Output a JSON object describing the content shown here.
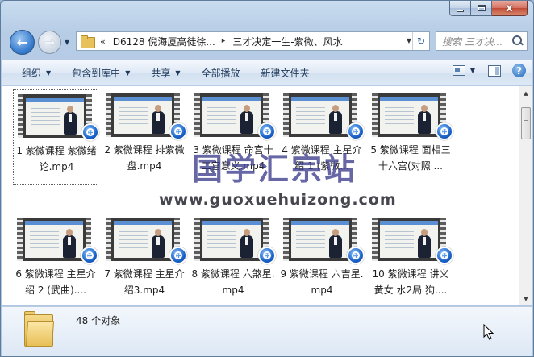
{
  "window": {
    "caption_buttons": {
      "minimize": "—",
      "maximize": "□",
      "close": "x"
    }
  },
  "navigation": {
    "back_icon": "back-arrow-icon",
    "forward_icon": "forward-arrow-icon"
  },
  "address": {
    "overflow_chevron": "«",
    "crumbs": [
      "D6128 倪海厦高徒徐...",
      "三才决定一生-紫微、风水"
    ],
    "separator": "▸"
  },
  "search": {
    "placeholder": "搜索 三才决..."
  },
  "toolbar": {
    "organize": "组织",
    "include_in_library": "包含到库中",
    "share": "共享",
    "play_all": "全部播放",
    "new_folder": "新建文件夹"
  },
  "files": [
    {
      "name": "1 紫微课程 紫微绪论.mp4",
      "selected": true
    },
    {
      "name": "2 紫微课程 排紫微盘.mp4",
      "selected": false
    },
    {
      "name": "3 紫微课程 命宫十二宫意义.mp4",
      "selected": false
    },
    {
      "name": "4 紫微课程 主星介绍 1 (紫微...",
      "selected": false
    },
    {
      "name": "5 紫微课程 面相三十六宫(对照 ...",
      "selected": false
    },
    {
      "name": "6 紫微课程 主星介绍 2 (武曲)....",
      "selected": false
    },
    {
      "name": "7 紫微课程 主星介绍3.mp4",
      "selected": false
    },
    {
      "name": "8 紫微课程 六煞星.mp4",
      "selected": false
    },
    {
      "name": "9 紫微课程 六吉星.mp4",
      "selected": false
    },
    {
      "name": "10 紫微课程 讲义黄女 水2局 狗....",
      "selected": false
    }
  ],
  "watermark": {
    "title": "国学汇宗站",
    "url": "www.guoxuehuizong.com"
  },
  "details": {
    "item_count": "48 个对象"
  },
  "colors": {
    "accent": "#3c7fd0",
    "watermark": "#3c3c8c",
    "folder": "#e8c15a"
  }
}
